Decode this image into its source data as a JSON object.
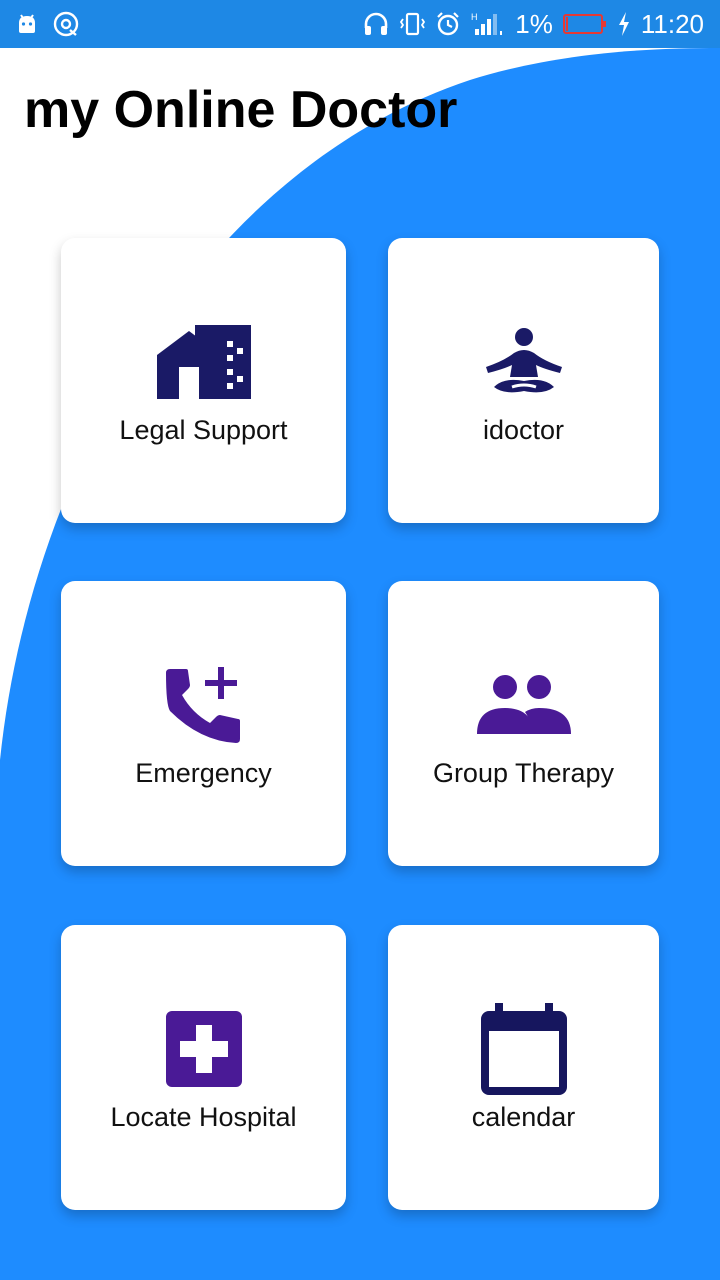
{
  "status_bar": {
    "battery_percent": "1%",
    "time": "11:20",
    "network_label": "H",
    "icons": [
      "android-icon",
      "sync-icon",
      "headphones-icon",
      "vibrate-icon",
      "alarm-icon",
      "signal-icon",
      "battery-icon",
      "charging-icon"
    ]
  },
  "app": {
    "title": "my Online Doctor"
  },
  "menu": [
    {
      "label": "Legal Support",
      "icon": "building-icon",
      "icon_color": "#1a1a66"
    },
    {
      "label": "idoctor",
      "icon": "meditation-icon",
      "icon_color": "#1a1a66"
    },
    {
      "label": "Emergency",
      "icon": "phone-add-icon",
      "icon_color": "#4a1a96"
    },
    {
      "label": "Group Therapy",
      "icon": "group-icon",
      "icon_color": "#4a1a96"
    },
    {
      "label": "Locate Hospital",
      "icon": "hospital-icon",
      "icon_color": "#4a1a96"
    },
    {
      "label": "calendar",
      "icon": "calendar-icon",
      "icon_color": "#16165e"
    }
  ],
  "colors": {
    "status_bar": "#1e88e5",
    "background_accent": "#1e8cff",
    "card": "#ffffff",
    "battery_warning": "#e53935"
  }
}
